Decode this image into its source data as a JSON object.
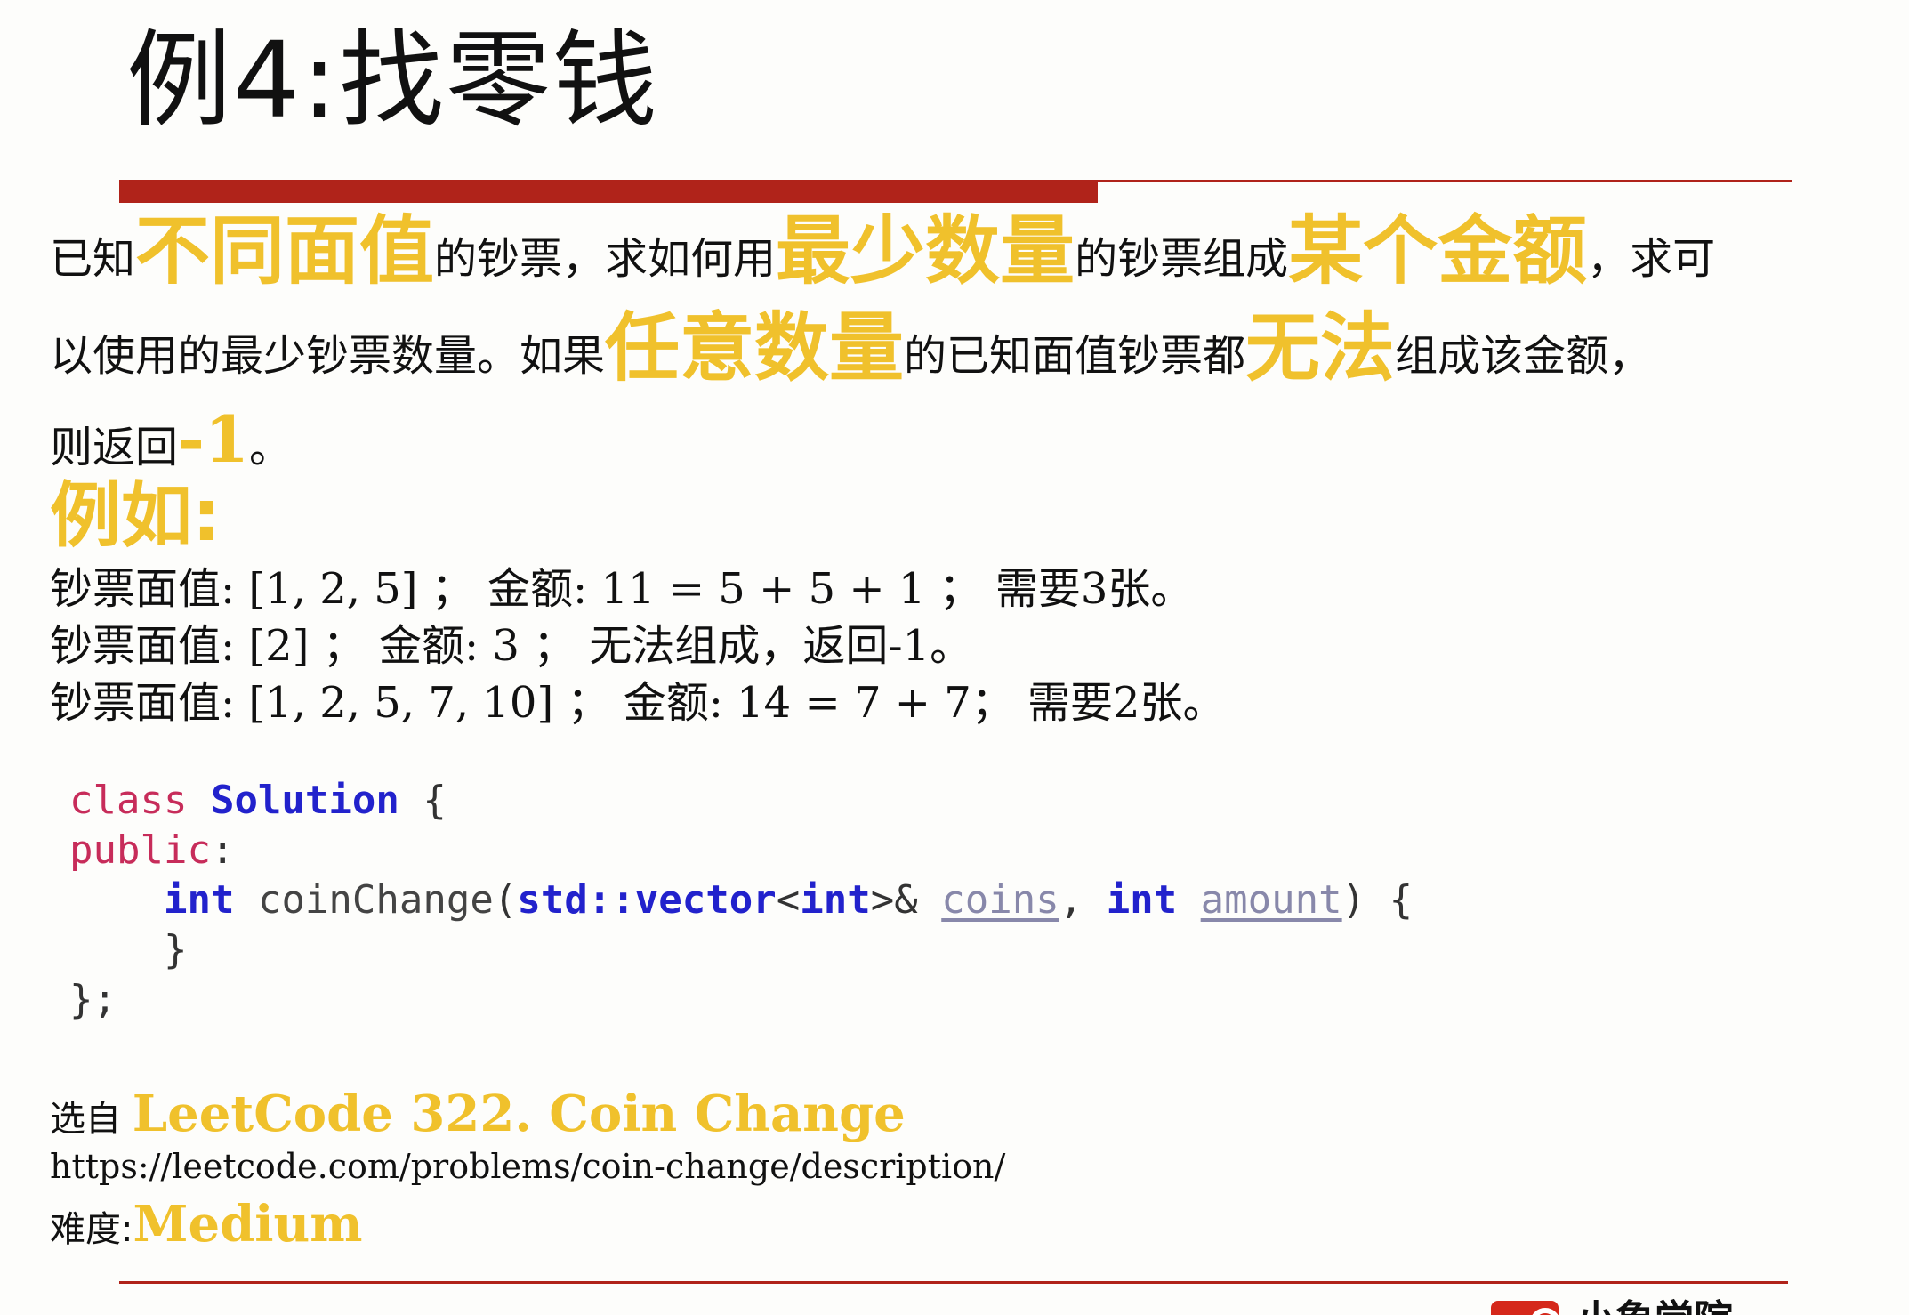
{
  "title": "例4:找零钱",
  "problem": {
    "l1_a": "已知",
    "l1_hl1": "不同面值",
    "l1_b": "的钞票，求如何用",
    "l1_hl2": "最少数量",
    "l1_c": "的钞票组成",
    "l1_hl3": "某个金额",
    "l1_d": "，求可",
    "l2_a": "以使用的最少钞票数量。如果",
    "l2_hl1": "任意数量",
    "l2_b": "的已知面值钞票都",
    "l2_hl2": "无法",
    "l2_c": "组成该金额，",
    "l3_a": "则返回",
    "l3_hl": "-1",
    "l3_b": "。"
  },
  "examples_heading": "例如:",
  "examples": [
    "钞票面值: [1, 2, 5] ； 金额: 11 = 5 + 5 + 1 ； 需要3张。",
    "钞票面值: [2] ； 金额: 3 ； 无法组成，返回-1。",
    "钞票面值: [1, 2, 5, 7, 10] ； 金额: 14 = 7 + 7； 需要2张。"
  ],
  "code": {
    "class_kw": "class",
    "class_name": "Solution",
    "open_brace": "{",
    "public_kw": "public",
    "colon": ":",
    "ret_type": "int",
    "fn_name": "coinChange",
    "paren_open": "(",
    "ns": "std::vector",
    "tmpl_open": "<",
    "tmpl_type": "int",
    "tmpl_close": ">&",
    "param1": "coins",
    "comma": ",",
    "param2_type": "int",
    "param2": "amount",
    "paren_close": ")",
    "body_open": "{",
    "body_close": "}",
    "class_close": "};"
  },
  "source": {
    "prefix": "选自",
    "title": "LeetCode 322. Coin Change",
    "url": "https://leetcode.com/problems/coin-change/description/"
  },
  "difficulty": {
    "label": "难度:",
    "value": "Medium"
  },
  "logo": {
    "text": "小象学院"
  },
  "colors": {
    "highlight": "#f0c12c",
    "rule": "#b0231a",
    "keyword": "#c72c5a",
    "type": "#2222cc"
  }
}
